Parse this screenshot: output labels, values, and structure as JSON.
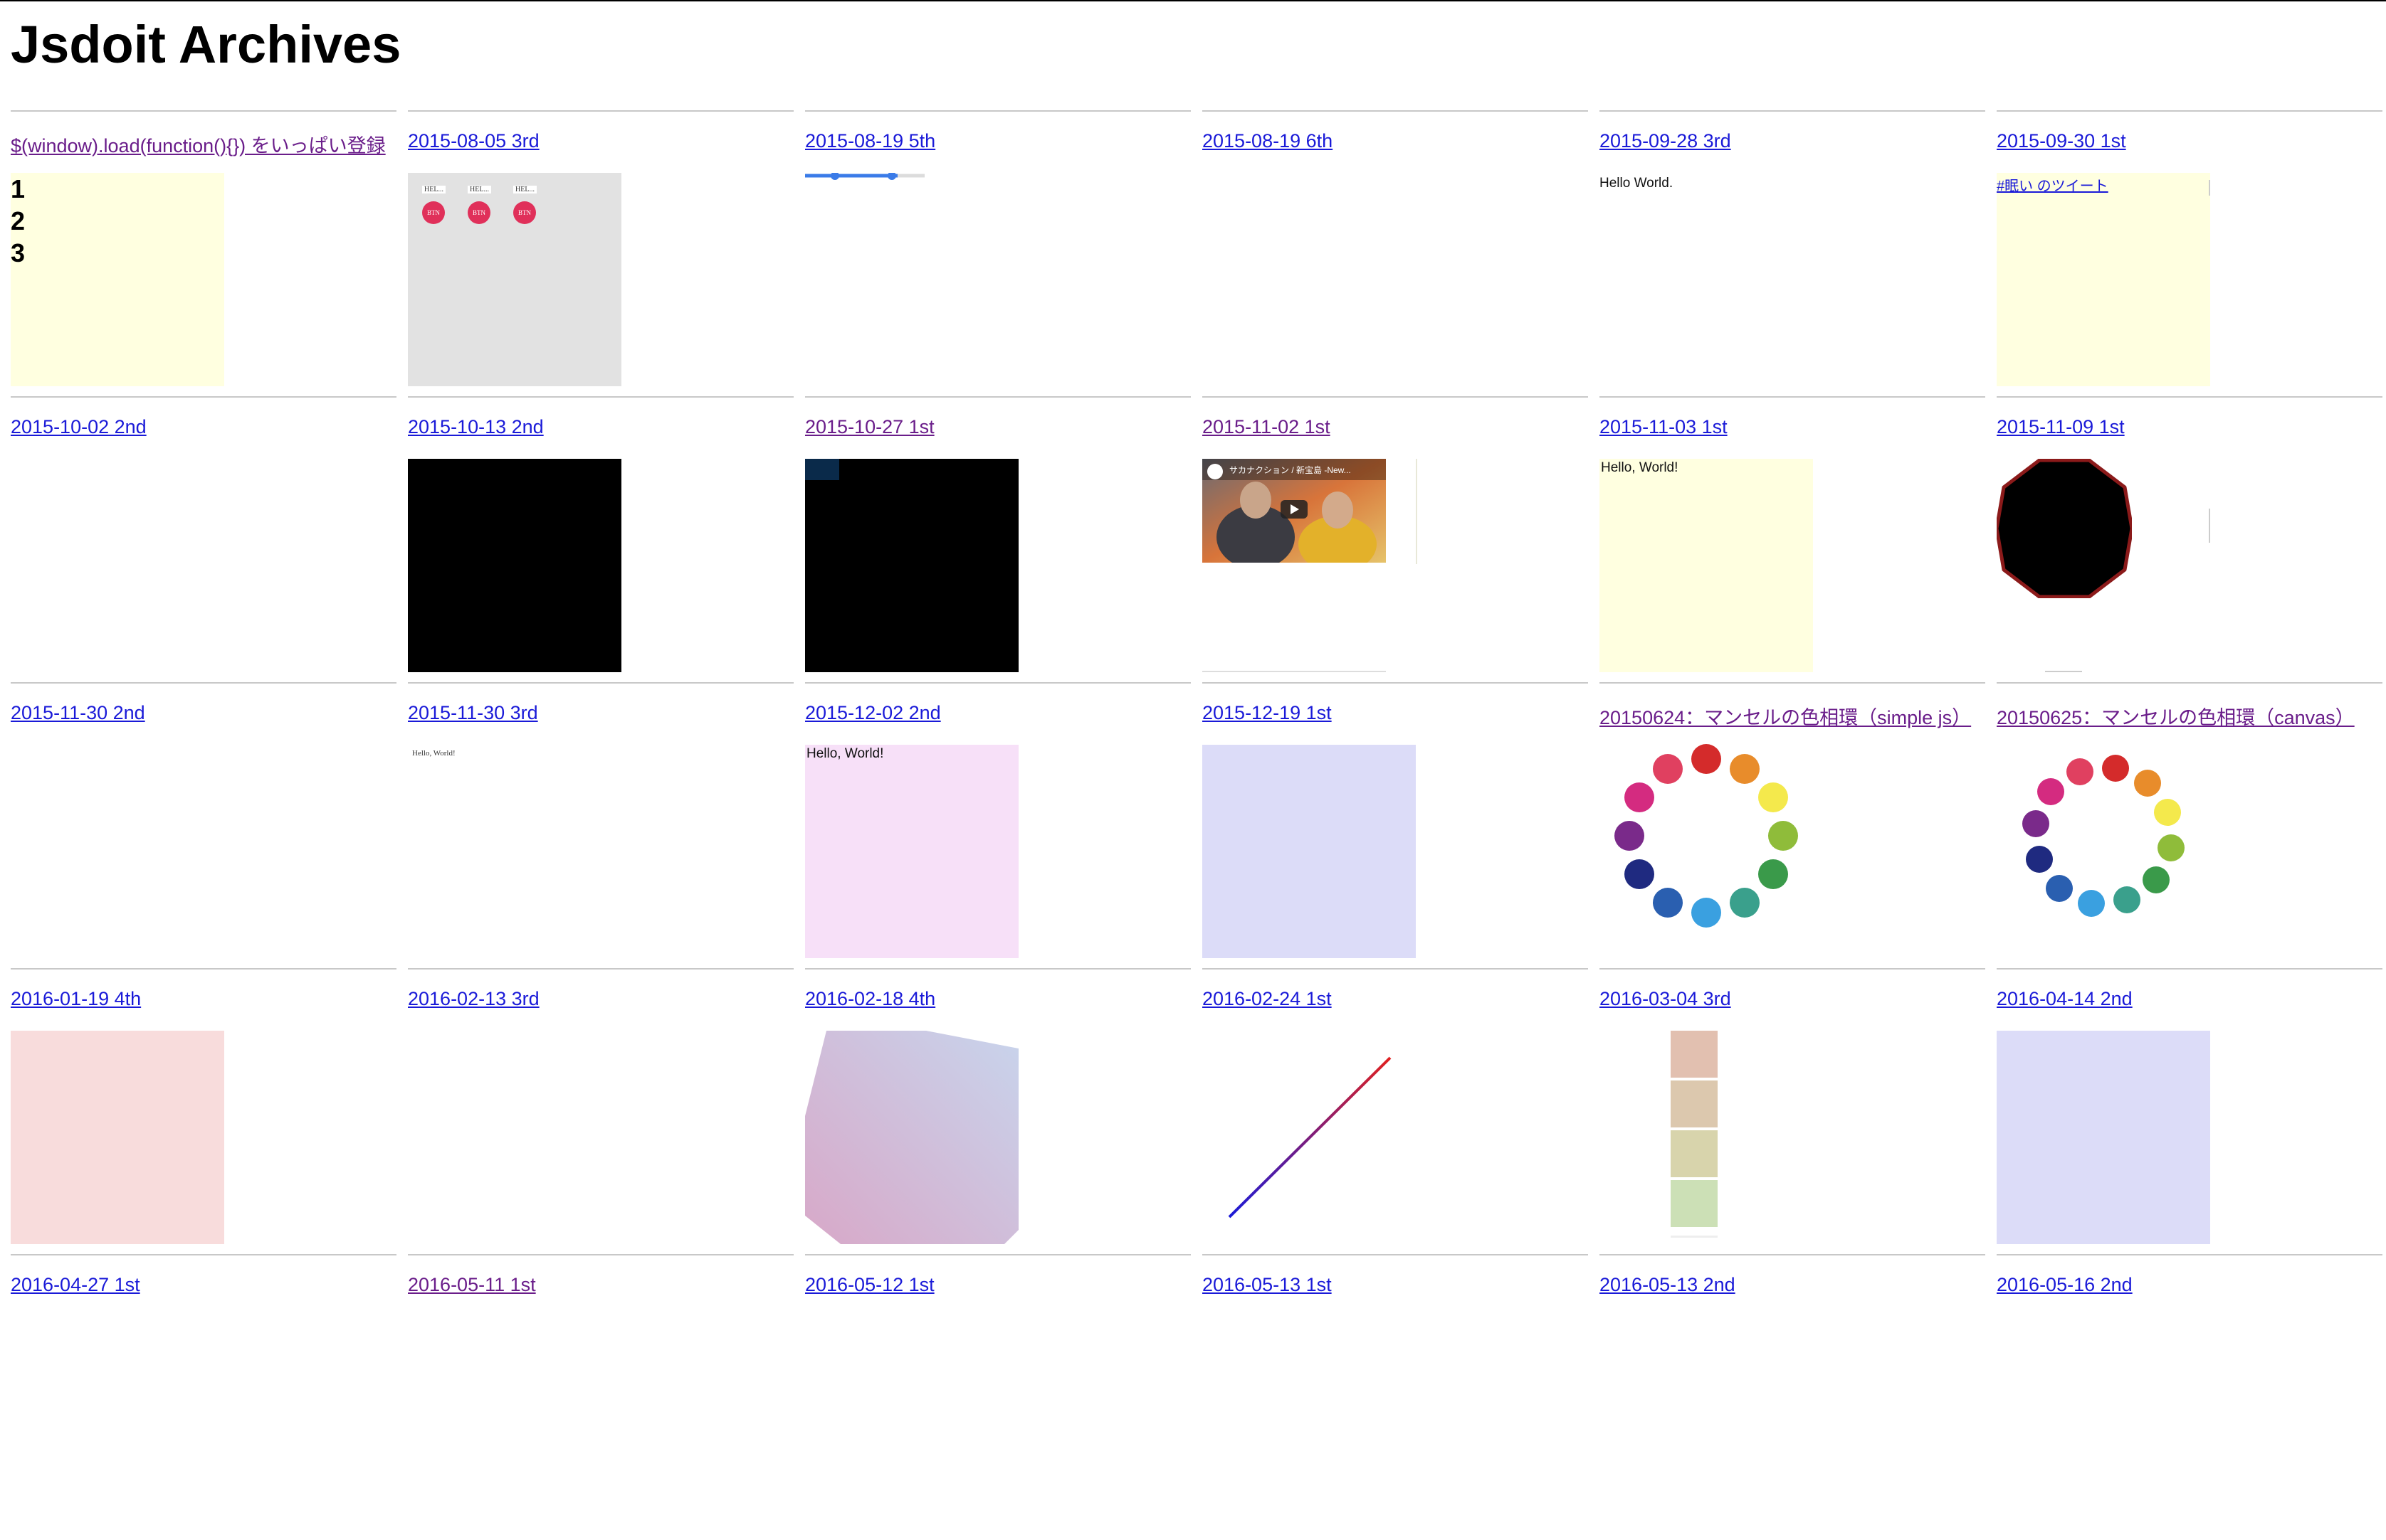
{
  "page": {
    "title": "Jsdoit Archives"
  },
  "colors": {
    "link": "#1a1ad8",
    "visited": "#6a1d8a",
    "cream": "#ffffe0",
    "pink": "#f7e0f8",
    "lavender": "#dcdcf8",
    "rose": "#f8dcdc",
    "gray": "#e2e2e2"
  },
  "entries": [
    {
      "title": "$(window).load(function(){}) をいっぱい登録",
      "visited": true
    },
    {
      "title": "2015-08-05 3rd"
    },
    {
      "title": "2015-08-19 5th"
    },
    {
      "title": "2015-08-19 6th"
    },
    {
      "title": "2015-09-28 3rd"
    },
    {
      "title": "2015-09-30 1st"
    },
    {
      "title": "2015-10-02 2nd"
    },
    {
      "title": "2015-10-13 2nd"
    },
    {
      "title": "2015-10-27 1st",
      "visited": true
    },
    {
      "title": "2015-11-02 1st",
      "visited": true
    },
    {
      "title": "2015-11-03 1st"
    },
    {
      "title": "2015-11-09 1st"
    },
    {
      "title": "2015-11-30 2nd"
    },
    {
      "title": "2015-11-30 3rd"
    },
    {
      "title": "2015-12-02 2nd"
    },
    {
      "title": "2015-12-19 1st"
    },
    {
      "title": "20150624：マンセルの色相環（simple js）",
      "visited": true
    },
    {
      "title": "20150625：マンセルの色相環（canvas）",
      "visited": true
    },
    {
      "title": "2016-01-19 4th"
    },
    {
      "title": "2016-02-13 3rd"
    },
    {
      "title": "2016-02-18 4th"
    },
    {
      "title": "2016-02-24 1st"
    },
    {
      "title": "2016-03-04 3rd"
    },
    {
      "title": "2016-04-14 2nd"
    },
    {
      "title": "2016-04-27 1st"
    },
    {
      "title": "2016-05-11 1st",
      "visited": true
    },
    {
      "title": "2016-05-12 1st"
    },
    {
      "title": "2016-05-13 1st"
    },
    {
      "title": "2016-05-13 2nd"
    },
    {
      "title": "2016-05-16 2nd"
    }
  ],
  "previews": {
    "list_numbers": [
      "1",
      "2",
      "3"
    ],
    "hello_buttons": {
      "label": "HEL...",
      "button": "BTN"
    },
    "hello_world_period": "Hello World.",
    "tweet_link": "#眠い のツイート",
    "hello_world": "Hello, World!",
    "video_caption": "サカナクション / 新宝島 -New...",
    "munsell_colors": [
      "#d42b2b",
      "#e88c2b",
      "#f4e94c",
      "#8fbc3a",
      "#3a9a4a",
      "#3aa08c",
      "#3aa0e0",
      "#2a5fb0",
      "#1f2a80",
      "#7a2a8a",
      "#d42b80",
      "#e04060"
    ]
  }
}
